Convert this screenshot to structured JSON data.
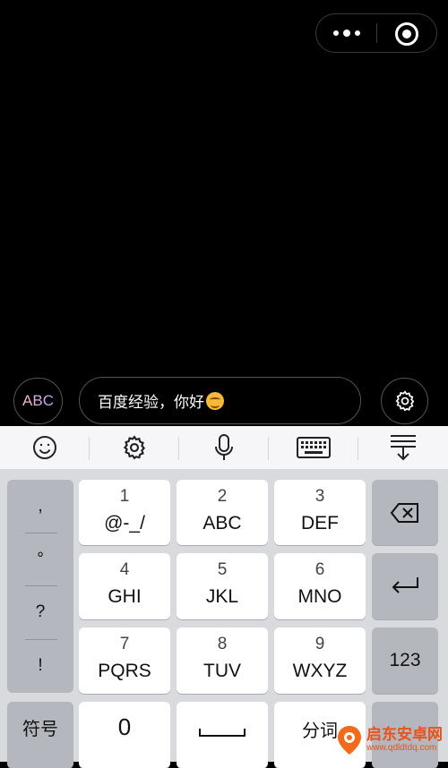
{
  "input": {
    "mode_label": "ABC",
    "text": "百度经验，你好"
  },
  "keyboard": {
    "punctuation": [
      ",",
      "°",
      "?",
      "!"
    ],
    "keys": [
      {
        "num": "1",
        "letters": "@-_/"
      },
      {
        "num": "2",
        "letters": "ABC"
      },
      {
        "num": "3",
        "letters": "DEF"
      },
      {
        "num": "4",
        "letters": "GHI"
      },
      {
        "num": "5",
        "letters": "JKL"
      },
      {
        "num": "6",
        "letters": "MNO"
      },
      {
        "num": "7",
        "letters": "PQRS"
      },
      {
        "num": "8",
        "letters": "TUV"
      },
      {
        "num": "9",
        "letters": "WXYZ"
      }
    ],
    "num_key": "123",
    "symbol_key": "符号",
    "zero_key": "0",
    "fenci_key": "分词"
  },
  "watermark": {
    "text": "启东安卓网",
    "url": "www.qdldtdq.com"
  },
  "colors": {
    "background": "#000000",
    "keyboard_bg": "#d8dade",
    "key_bg": "#ffffff",
    "func_key_bg": "#b4b7be",
    "abc_gradient": [
      "#ffb3c7",
      "#b9a7ff"
    ]
  }
}
